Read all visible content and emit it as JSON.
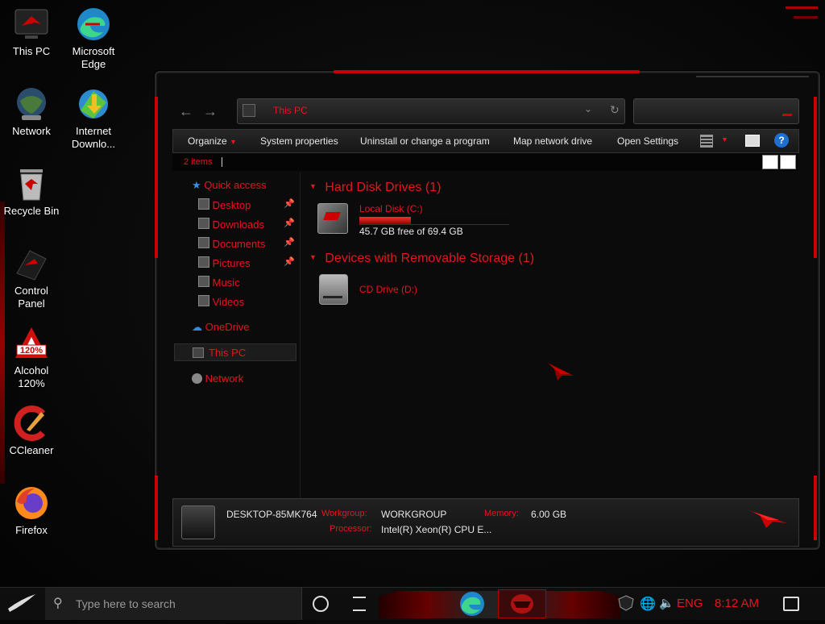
{
  "desktop": {
    "icons": [
      {
        "label": "This PC",
        "icon": "this-pc-icon"
      },
      {
        "label": "Microsoft Edge",
        "icon": "edge-icon"
      },
      {
        "label": "Network",
        "icon": "network-icon"
      },
      {
        "label": "Internet Downlo...",
        "icon": "internet-download-manager-icon"
      },
      {
        "label": "Recycle Bin",
        "icon": "recycle-bin-icon"
      },
      {
        "label": "Control Panel",
        "icon": "control-panel-icon"
      },
      {
        "label": "Alcohol 120%",
        "icon": "alcohol-120-icon"
      },
      {
        "label": "CCleaner",
        "icon": "ccleaner-icon"
      },
      {
        "label": "Firefox",
        "icon": "firefox-icon"
      }
    ]
  },
  "explorer": {
    "address": "This PC",
    "toolbar": {
      "organize": "Organize",
      "system_properties": "System properties",
      "uninstall": "Uninstall or change a program",
      "map_drive": "Map network drive",
      "open_settings": "Open Settings",
      "help": "?"
    },
    "status": {
      "items": "2 items"
    },
    "nav": {
      "quick_access": "Quick access",
      "desktop": "Desktop",
      "downloads": "Downloads",
      "documents": "Documents",
      "pictures": "Pictures",
      "music": "Music",
      "videos": "Videos",
      "onedrive": "OneDrive",
      "this_pc": "This PC",
      "network": "Network"
    },
    "groups": {
      "hdd_title": "Hard Disk Drives (1)",
      "removable_title": "Devices with Removable Storage (1)"
    },
    "drives": {
      "c_name": "Local Disk (C:)",
      "c_free": "45.7 GB free of 69.4 GB",
      "c_used_fraction": 0.342,
      "d_name": "CD Drive (D:)"
    },
    "details": {
      "computer_name": "DESKTOP-85MK764",
      "workgroup_label": "Workgroup:",
      "workgroup": "WORKGROUP",
      "memory_label": "Memory:",
      "memory": "6.00 GB",
      "processor_label": "Processor:",
      "processor": "Intel(R) Xeon(R) CPU E..."
    }
  },
  "taskbar": {
    "search_placeholder": "Type here to search",
    "language": "ENG",
    "time": "8:12 AM"
  },
  "colors": {
    "accent": "#e8141e",
    "background": "#0b0b0b"
  }
}
